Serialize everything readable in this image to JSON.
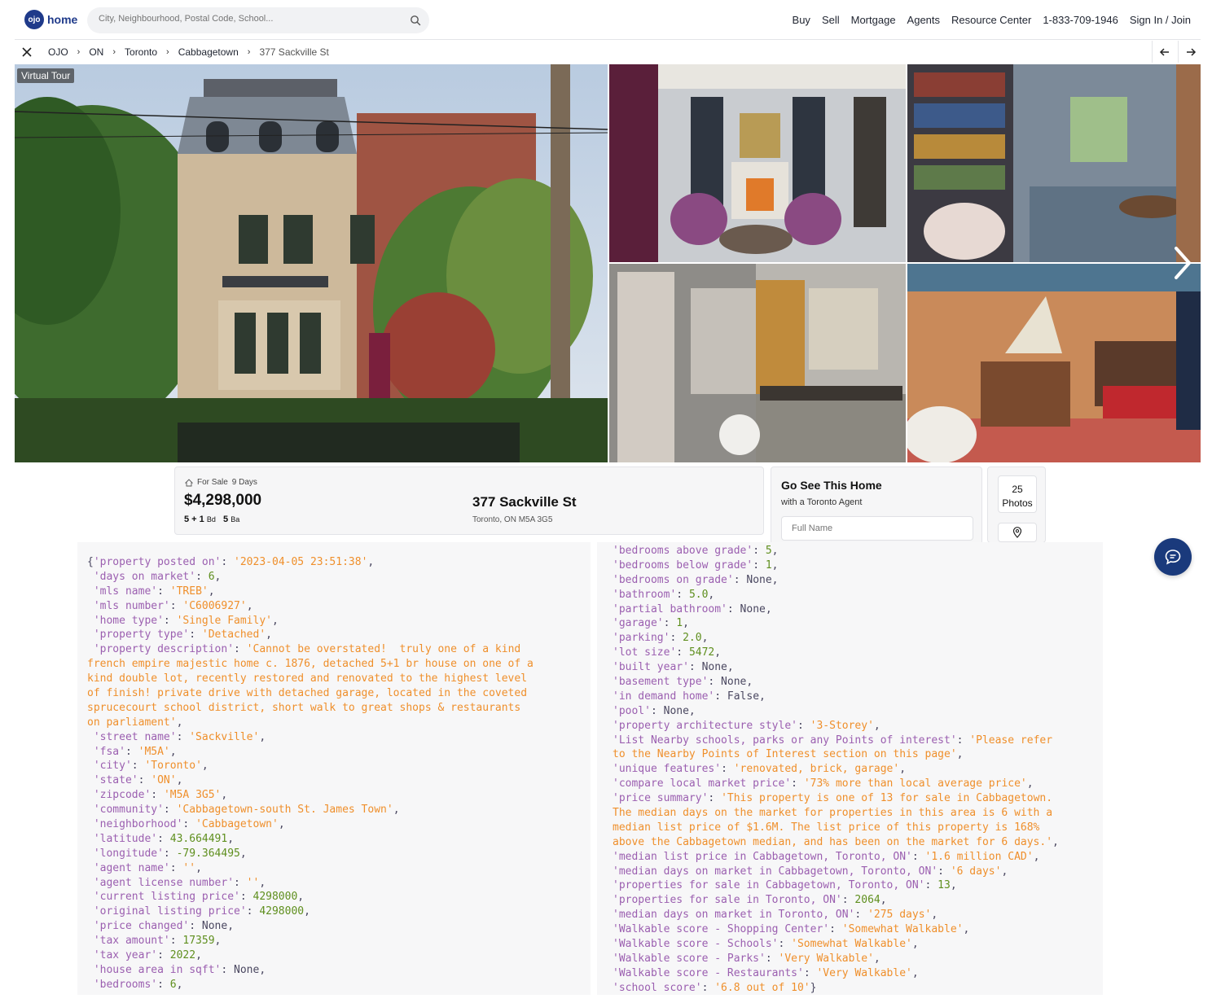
{
  "header": {
    "logo_mark": "ojo",
    "logo_text": "home",
    "search_placeholder": "City, Neighbourhood, Postal Code, School...",
    "nav": [
      "Buy",
      "Sell",
      "Mortgage",
      "Agents",
      "Resource Center",
      "1-833-709-1946",
      "Sign In / Join"
    ]
  },
  "breadcrumb": [
    "OJO",
    "ON",
    "Toronto",
    "Cabbagetown",
    "377 Sackville St"
  ],
  "gallery": {
    "badge": "Virtual Tour",
    "icons": [
      "close-icon",
      "arrow-left-icon",
      "arrow-right-icon",
      "chevron-right-icon"
    ]
  },
  "listing": {
    "status": "For Sale",
    "days": "9 Days",
    "price": "$4,298,000",
    "beds": "5 + 1",
    "beds_unit": "Bd",
    "baths": "5",
    "baths_unit": "Ba",
    "address": "377 Sackville St",
    "address_sub": "Toronto, ON M5A 3G5"
  },
  "agent_card": {
    "title": "Go See This Home",
    "subtitle": "with a Toronto Agent",
    "name_placeholder": "Full Name"
  },
  "photos_button": {
    "count": "25",
    "label": "Photos"
  },
  "colors": {
    "brand": "#1f3a8a",
    "key": "#9b5fb0",
    "string": "#ef8f2b",
    "number": "#5f8f1e",
    "chat": "#1a3a7c"
  },
  "code_left": [
    [
      [
        "p",
        "{"
      ],
      [
        "k",
        "'property posted on'"
      ],
      [
        "p",
        ": "
      ],
      [
        "s",
        "'2023-04-05 23:51:38'"
      ],
      [
        "p",
        ","
      ]
    ],
    [
      [
        "p",
        " "
      ],
      [
        "k",
        "'days on market'"
      ],
      [
        "p",
        ": "
      ],
      [
        "n",
        "6"
      ],
      [
        "p",
        ","
      ]
    ],
    [
      [
        "p",
        " "
      ],
      [
        "k",
        "'mls name'"
      ],
      [
        "p",
        ": "
      ],
      [
        "s",
        "'TREB'"
      ],
      [
        "p",
        ","
      ]
    ],
    [
      [
        "p",
        " "
      ],
      [
        "k",
        "'mls number'"
      ],
      [
        "p",
        ": "
      ],
      [
        "s",
        "'C6006927'"
      ],
      [
        "p",
        ","
      ]
    ],
    [
      [
        "p",
        " "
      ],
      [
        "k",
        "'home type'"
      ],
      [
        "p",
        ": "
      ],
      [
        "s",
        "'Single Family'"
      ],
      [
        "p",
        ","
      ]
    ],
    [
      [
        "p",
        " "
      ],
      [
        "k",
        "'property type'"
      ],
      [
        "p",
        ": "
      ],
      [
        "s",
        "'Detached'"
      ],
      [
        "p",
        ","
      ]
    ],
    [
      [
        "p",
        " "
      ],
      [
        "k",
        "'property description'"
      ],
      [
        "p",
        ": "
      ],
      [
        "s",
        "'Cannot be overstated!  truly one of a kind"
      ]
    ],
    [
      [
        "s",
        "french empire majestic home c. 1876, detached 5+1 br house on one of a"
      ]
    ],
    [
      [
        "s",
        "kind double lot, recently restored and renovated to the highest level"
      ]
    ],
    [
      [
        "s",
        "of finish! private drive with detached garage, located in the coveted"
      ]
    ],
    [
      [
        "s",
        "sprucecourt school district, short walk to great shops & restaurants"
      ]
    ],
    [
      [
        "s",
        "on parliament'"
      ],
      [
        "p",
        ","
      ]
    ],
    [
      [
        "p",
        " "
      ],
      [
        "k",
        "'street name'"
      ],
      [
        "p",
        ": "
      ],
      [
        "s",
        "'Sackville'"
      ],
      [
        "p",
        ","
      ]
    ],
    [
      [
        "p",
        " "
      ],
      [
        "k",
        "'fsa'"
      ],
      [
        "p",
        ": "
      ],
      [
        "s",
        "'M5A'"
      ],
      [
        "p",
        ","
      ]
    ],
    [
      [
        "p",
        " "
      ],
      [
        "k",
        "'city'"
      ],
      [
        "p",
        ": "
      ],
      [
        "s",
        "'Toronto'"
      ],
      [
        "p",
        ","
      ]
    ],
    [
      [
        "p",
        " "
      ],
      [
        "k",
        "'state'"
      ],
      [
        "p",
        ": "
      ],
      [
        "s",
        "'ON'"
      ],
      [
        "p",
        ","
      ]
    ],
    [
      [
        "p",
        " "
      ],
      [
        "k",
        "'zipcode'"
      ],
      [
        "p",
        ": "
      ],
      [
        "s",
        "'M5A 3G5'"
      ],
      [
        "p",
        ","
      ]
    ],
    [
      [
        "p",
        " "
      ],
      [
        "k",
        "'community'"
      ],
      [
        "p",
        ": "
      ],
      [
        "s",
        "'Cabbagetown-south St. James Town'"
      ],
      [
        "p",
        ","
      ]
    ],
    [
      [
        "p",
        " "
      ],
      [
        "k",
        "'neighborhood'"
      ],
      [
        "p",
        ": "
      ],
      [
        "s",
        "'Cabbagetown'"
      ],
      [
        "p",
        ","
      ]
    ],
    [
      [
        "p",
        " "
      ],
      [
        "k",
        "'latitude'"
      ],
      [
        "p",
        ": "
      ],
      [
        "n",
        "43.664491"
      ],
      [
        "p",
        ","
      ]
    ],
    [
      [
        "p",
        " "
      ],
      [
        "k",
        "'longitude'"
      ],
      [
        "p",
        ": "
      ],
      [
        "n",
        "-79.364495"
      ],
      [
        "p",
        ","
      ]
    ],
    [
      [
        "p",
        " "
      ],
      [
        "k",
        "'agent name'"
      ],
      [
        "p",
        ": "
      ],
      [
        "s",
        "''"
      ],
      [
        "p",
        ","
      ]
    ],
    [
      [
        "p",
        " "
      ],
      [
        "k",
        "'agent license number'"
      ],
      [
        "p",
        ": "
      ],
      [
        "s",
        "''"
      ],
      [
        "p",
        ","
      ]
    ],
    [
      [
        "p",
        " "
      ],
      [
        "k",
        "'current listing price'"
      ],
      [
        "p",
        ": "
      ],
      [
        "n",
        "4298000"
      ],
      [
        "p",
        ","
      ]
    ],
    [
      [
        "p",
        " "
      ],
      [
        "k",
        "'original listing price'"
      ],
      [
        "p",
        ": "
      ],
      [
        "n",
        "4298000"
      ],
      [
        "p",
        ","
      ]
    ],
    [
      [
        "p",
        " "
      ],
      [
        "k",
        "'price changed'"
      ],
      [
        "p",
        ": None,"
      ]
    ],
    [
      [
        "p",
        " "
      ],
      [
        "k",
        "'tax amount'"
      ],
      [
        "p",
        ": "
      ],
      [
        "n",
        "17359"
      ],
      [
        "p",
        ","
      ]
    ],
    [
      [
        "p",
        " "
      ],
      [
        "k",
        "'tax year'"
      ],
      [
        "p",
        ": "
      ],
      [
        "n",
        "2022"
      ],
      [
        "p",
        ","
      ]
    ],
    [
      [
        "p",
        " "
      ],
      [
        "k",
        "'house area in sqft'"
      ],
      [
        "p",
        ": None,"
      ]
    ],
    [
      [
        "p",
        " "
      ],
      [
        "k",
        "'bedrooms'"
      ],
      [
        "p",
        ": "
      ],
      [
        "n",
        "6"
      ],
      [
        "p",
        ","
      ]
    ]
  ],
  "code_right": [
    [
      [
        "k",
        "'bedrooms above grade'"
      ],
      [
        "p",
        ": "
      ],
      [
        "n",
        "5"
      ],
      [
        "p",
        ","
      ]
    ],
    [
      [
        "k",
        "'bedrooms below grade'"
      ],
      [
        "p",
        ": "
      ],
      [
        "n",
        "1"
      ],
      [
        "p",
        ","
      ]
    ],
    [
      [
        "k",
        "'bedrooms on grade'"
      ],
      [
        "p",
        ": None,"
      ]
    ],
    [
      [
        "k",
        "'bathroom'"
      ],
      [
        "p",
        ": "
      ],
      [
        "n",
        "5.0"
      ],
      [
        "p",
        ","
      ]
    ],
    [
      [
        "k",
        "'partial bathroom'"
      ],
      [
        "p",
        ": None,"
      ]
    ],
    [
      [
        "k",
        "'garage'"
      ],
      [
        "p",
        ": "
      ],
      [
        "n",
        "1"
      ],
      [
        "p",
        ","
      ]
    ],
    [
      [
        "k",
        "'parking'"
      ],
      [
        "p",
        ": "
      ],
      [
        "n",
        "2.0"
      ],
      [
        "p",
        ","
      ]
    ],
    [
      [
        "k",
        "'lot size'"
      ],
      [
        "p",
        ": "
      ],
      [
        "n",
        "5472"
      ],
      [
        "p",
        ","
      ]
    ],
    [
      [
        "k",
        "'built year'"
      ],
      [
        "p",
        ": None,"
      ]
    ],
    [
      [
        "k",
        "'basement type'"
      ],
      [
        "p",
        ": None,"
      ]
    ],
    [
      [
        "k",
        "'in demand home'"
      ],
      [
        "p",
        ": False,"
      ]
    ],
    [
      [
        "k",
        "'pool'"
      ],
      [
        "p",
        ": None,"
      ]
    ],
    [
      [
        "k",
        "'property architecture style'"
      ],
      [
        "p",
        ": "
      ],
      [
        "s",
        "'3-Storey'"
      ],
      [
        "p",
        ","
      ]
    ],
    [
      [
        "k",
        "'List Nearby schools, parks or any Points of interest'"
      ],
      [
        "p",
        ": "
      ],
      [
        "s",
        "'Please refer"
      ]
    ],
    [
      [
        "s",
        "to the Nearby Points of Interest section on this page'"
      ],
      [
        "p",
        ","
      ]
    ],
    [
      [
        "k",
        "'unique features'"
      ],
      [
        "p",
        ": "
      ],
      [
        "s",
        "'renovated, brick, garage'"
      ],
      [
        "p",
        ","
      ]
    ],
    [
      [
        "k",
        "'compare local market price'"
      ],
      [
        "p",
        ": "
      ],
      [
        "s",
        "'73% more than local average price'"
      ],
      [
        "p",
        ","
      ]
    ],
    [
      [
        "k",
        "'price summary'"
      ],
      [
        "p",
        ": "
      ],
      [
        "s",
        "'This property is one of 13 for sale in Cabbagetown."
      ]
    ],
    [
      [
        "s",
        "The median days on the market for properties in this area is 6 with a"
      ]
    ],
    [
      [
        "s",
        "median list price of $1.6M. The list price of this property is 168%"
      ]
    ],
    [
      [
        "s",
        "above the Cabbagetown median, and has been on the market for 6 days.'"
      ],
      [
        "p",
        ","
      ]
    ],
    [
      [
        "k",
        "'median list price in Cabbagetown, Toronto, ON'"
      ],
      [
        "p",
        ": "
      ],
      [
        "s",
        "'1.6 million CAD'"
      ],
      [
        "p",
        ","
      ]
    ],
    [
      [
        "k",
        "'median days on market in Cabbagetown, Toronto, ON'"
      ],
      [
        "p",
        ": "
      ],
      [
        "s",
        "'6 days'"
      ],
      [
        "p",
        ","
      ]
    ],
    [
      [
        "k",
        "'properties for sale in Cabbagetown, Toronto, ON'"
      ],
      [
        "p",
        ": "
      ],
      [
        "n",
        "13"
      ],
      [
        "p",
        ","
      ]
    ],
    [
      [
        "k",
        "'properties for sale in Toronto, ON'"
      ],
      [
        "p",
        ": "
      ],
      [
        "n",
        "2064"
      ],
      [
        "p",
        ","
      ]
    ],
    [
      [
        "k",
        "'median days on market in Toronto, ON'"
      ],
      [
        "p",
        ": "
      ],
      [
        "s",
        "'275 days'"
      ],
      [
        "p",
        ","
      ]
    ],
    [
      [
        "k",
        "'Walkable score - Shopping Center'"
      ],
      [
        "p",
        ": "
      ],
      [
        "s",
        "'Somewhat Walkable'"
      ],
      [
        "p",
        ","
      ]
    ],
    [
      [
        "k",
        "'Walkable score - Schools'"
      ],
      [
        "p",
        ": "
      ],
      [
        "s",
        "'Somewhat Walkable'"
      ],
      [
        "p",
        ","
      ]
    ],
    [
      [
        "k",
        "'Walkable score - Parks'"
      ],
      [
        "p",
        ": "
      ],
      [
        "s",
        "'Very Walkable'"
      ],
      [
        "p",
        ","
      ]
    ],
    [
      [
        "k",
        "'Walkable score - Restaurants'"
      ],
      [
        "p",
        ": "
      ],
      [
        "s",
        "'Very Walkable'"
      ],
      [
        "p",
        ","
      ]
    ],
    [
      [
        "k",
        "'school score'"
      ],
      [
        "p",
        ": "
      ],
      [
        "s",
        "'6.8 out of 10'"
      ],
      [
        "p",
        "}"
      ]
    ]
  ]
}
